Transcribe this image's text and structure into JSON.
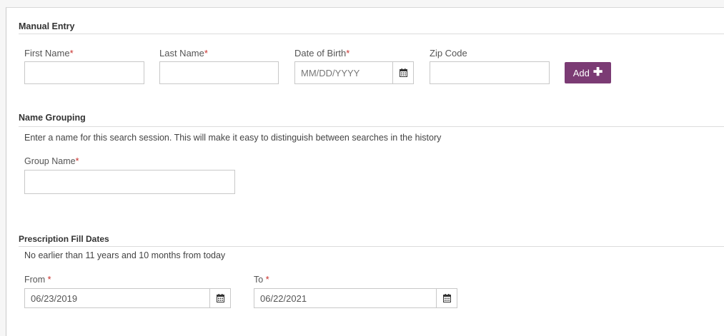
{
  "manual_entry": {
    "title": "Manual Entry",
    "first_name": {
      "label": "First Name",
      "required_mark": "*",
      "value": ""
    },
    "last_name": {
      "label": "Last Name",
      "required_mark": "*",
      "value": ""
    },
    "dob": {
      "label": "Date of Birth",
      "required_mark": "*",
      "placeholder": "MM/DD/YYYY",
      "value": ""
    },
    "zip": {
      "label": "Zip Code",
      "value": ""
    },
    "add_button": {
      "label": "Add",
      "icon": "plus-icon"
    }
  },
  "name_grouping": {
    "title": "Name Grouping",
    "description": "Enter a name for this search session. This will make it easy to distinguish between searches in the history",
    "group_name": {
      "label": "Group Name",
      "required_mark": "*",
      "value": ""
    }
  },
  "fill_dates": {
    "title": "Prescription Fill Dates",
    "description": "No earlier than 11 years and 10 months from today",
    "from": {
      "label": "From ",
      "required_mark": "*",
      "value": "06/23/2019"
    },
    "to": {
      "label": "To ",
      "required_mark": "*",
      "value": "06/22/2021"
    }
  },
  "colors": {
    "accent": "#7b3b74",
    "required": "#c9302c"
  }
}
